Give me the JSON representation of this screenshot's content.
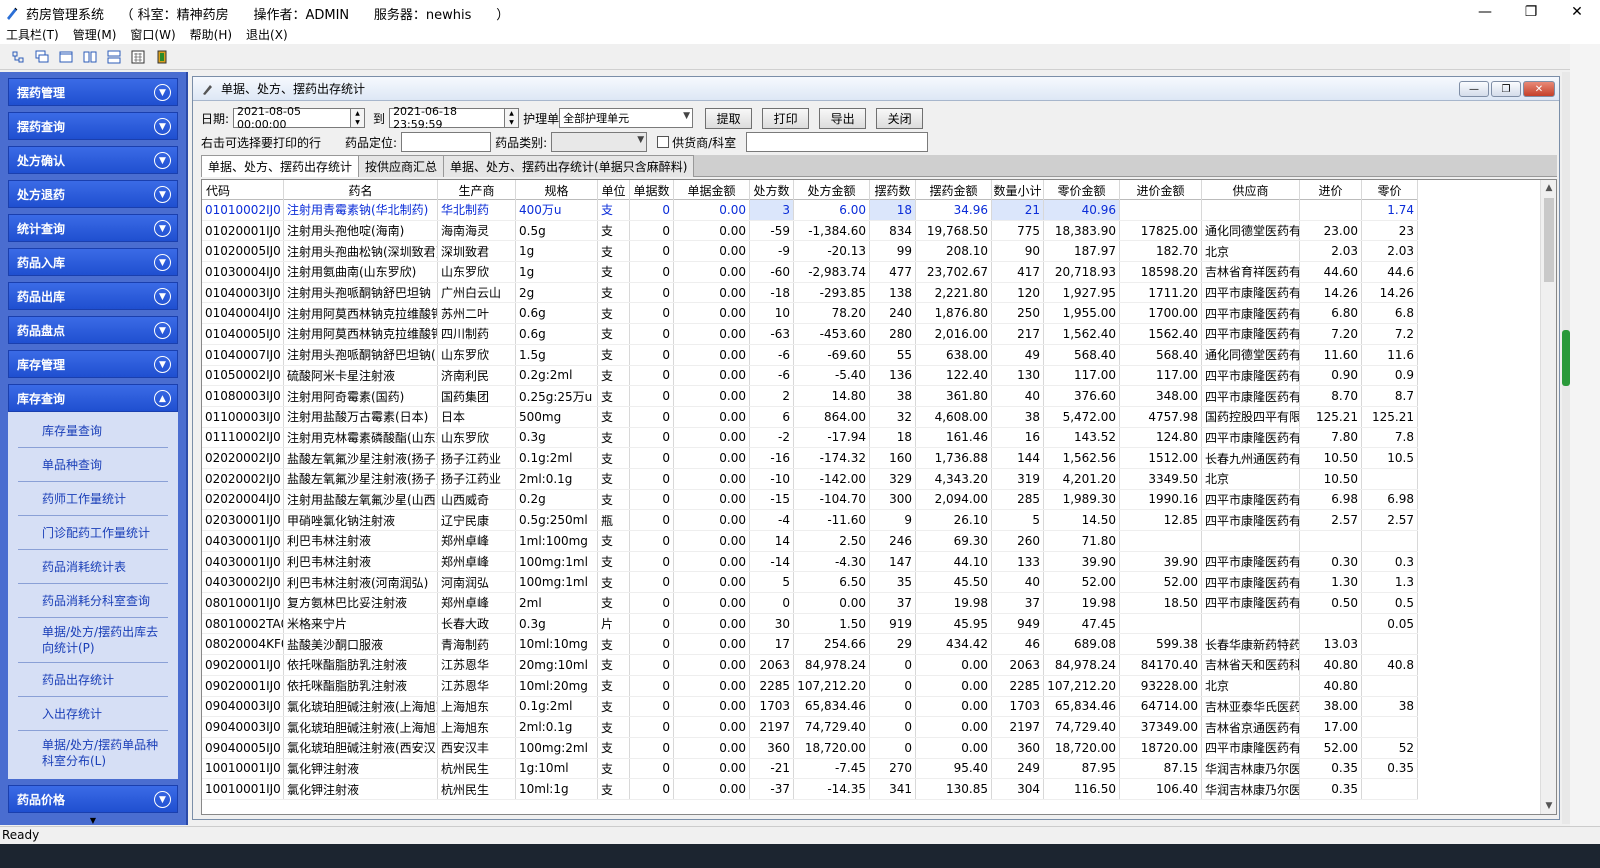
{
  "window": {
    "title": "药房管理系统    （ 科室：精神药房      操作者：ADMIN      服务器：newhis      ）",
    "minimize": "—",
    "maximize": "❐",
    "close": "✕"
  },
  "menu": [
    "工具栏(T)",
    "管理(M)",
    "窗口(W)",
    "帮助(H)",
    "退出(X)"
  ],
  "sidebar": {
    "groups": [
      {
        "label": "摆药管理"
      },
      {
        "label": "摆药查询"
      },
      {
        "label": "处方确认"
      },
      {
        "label": "处方退药"
      },
      {
        "label": "统计查询"
      },
      {
        "label": "药品入库"
      },
      {
        "label": "药品出库"
      },
      {
        "label": "药品盘点"
      },
      {
        "label": "库存管理"
      },
      {
        "label": "库存查询"
      }
    ],
    "submenu": [
      "库存量查询",
      "单品种查询",
      "药师工作量统计",
      "门诊配药工作量统计",
      "药品消耗统计表",
      "药品消耗分科室查询",
      "单据/处方/摆药出库去向统计(P)",
      "药品出存统计",
      "入出存统计",
      "单据/处方/摆药单品种科室分布(L)"
    ],
    "last_group": "药品价格"
  },
  "child": {
    "title": "单据、处方、摆药出存统计",
    "date_label": "日期:",
    "date_from": "2021-08-05 00:00:00",
    "to_label": "到",
    "date_to": "2021-06-18 23:59:59",
    "unit_label": "护理单",
    "unit_value": "全部护理单元",
    "btn_extract": "提取",
    "btn_print": "打印",
    "btn_export": "导出",
    "btn_close": "关闭",
    "hint": "右击可选择要打印的行",
    "locate_label": "药品定位:",
    "category_label": "药品类别:",
    "supplier_check": "供货商/科室",
    "tabs": [
      "单据、处方、摆药出存统计",
      "按供应商汇总",
      "单据、处方、摆药出存统计(单据只含麻醉料)"
    ]
  },
  "grid": {
    "columns": [
      "代码",
      "药名",
      "生产商",
      "规格",
      "单位",
      "单据数",
      "单据金额",
      "处方数",
      "处方金额",
      "摆药数",
      "摆药金额",
      "数量小计",
      "零价金额",
      "进价金额",
      "供应商",
      "进价",
      "零价"
    ],
    "rows": [
      [
        "01010002IJ0",
        "注射用青霉素钠(华北制药)",
        "华北制药",
        "400万u",
        "支",
        "0",
        "0.00",
        "3",
        "6.00",
        "18",
        "34.96",
        "21",
        "40.96",
        "",
        "",
        "",
        "1.74"
      ],
      [
        "01020001IJ0",
        "注射用头孢他啶(海南)",
        "海南海灵",
        "0.5g",
        "支",
        "0",
        "0.00",
        "-59",
        "-1,384.60",
        "834",
        "19,768.50",
        "775",
        "18,383.90",
        "17825.00",
        "通化同德堂医药有",
        "23.00",
        "23"
      ],
      [
        "01020005IJ0",
        "注射用头孢曲松钠(深圳致君)",
        "深圳致君",
        "1g",
        "支",
        "0",
        "0.00",
        "-9",
        "-20.13",
        "99",
        "208.10",
        "90",
        "187.97",
        "182.70",
        "北京",
        "2.03",
        "2.03"
      ],
      [
        "01030004IJ0",
        "注射用氨曲南(山东罗欣)",
        "山东罗欣",
        "1g",
        "支",
        "0",
        "0.00",
        "-60",
        "-2,983.74",
        "477",
        "23,702.67",
        "417",
        "20,718.93",
        "18598.20",
        "吉林省育祥医药有",
        "44.60",
        "44.6"
      ],
      [
        "01040003IJ0",
        "注射用头孢哌酮钠舒巴坦钠",
        "广州白云山",
        "2g",
        "支",
        "0",
        "0.00",
        "-18",
        "-293.85",
        "138",
        "2,221.80",
        "120",
        "1,927.95",
        "1711.20",
        "四平市康隆医药有",
        "14.26",
        "14.26"
      ],
      [
        "01040004IJ0",
        "注射用阿莫西林钠克拉维酸钾",
        "苏州二叶",
        "0.6g",
        "支",
        "0",
        "0.00",
        "10",
        "78.20",
        "240",
        "1,876.80",
        "250",
        "1,955.00",
        "1700.00",
        "四平市康隆医药有",
        "6.80",
        "6.8"
      ],
      [
        "01040005IJ0",
        "注射用阿莫西林钠克拉维酸钾",
        "四川制药",
        "0.6g",
        "支",
        "0",
        "0.00",
        "-63",
        "-453.60",
        "280",
        "2,016.00",
        "217",
        "1,562.40",
        "1562.40",
        "四平市康隆医药有",
        "7.20",
        "7.2"
      ],
      [
        "01040007IJ0",
        "注射用头孢哌酮钠舒巴坦钠(",
        "山东罗欣",
        "1.5g",
        "支",
        "0",
        "0.00",
        "-6",
        "-69.60",
        "55",
        "638.00",
        "49",
        "568.40",
        "568.40",
        "通化同德堂医药有",
        "11.60",
        "11.6"
      ],
      [
        "01050002IJ0",
        "硫酸阿米卡星注射液",
        "济南利民",
        "0.2g:2ml",
        "支",
        "0",
        "0.00",
        "-6",
        "-5.40",
        "136",
        "122.40",
        "130",
        "117.00",
        "117.00",
        "四平市康隆医药有",
        "0.90",
        "0.9"
      ],
      [
        "01080003IJ0",
        "注射用阿奇霉素(国药)",
        "国药集团",
        "0.25g:25万u",
        "支",
        "0",
        "0.00",
        "2",
        "14.80",
        "38",
        "361.80",
        "40",
        "376.60",
        "348.00",
        "四平市康隆医药有",
        "8.70",
        "8.7"
      ],
      [
        "01100003IJ0",
        "注射用盐酸万古霉素(日本)",
        "日本",
        "500mg",
        "支",
        "0",
        "0.00",
        "6",
        "864.00",
        "32",
        "4,608.00",
        "38",
        "5,472.00",
        "4757.98",
        "国药控股四平有限",
        "125.21",
        "125.21"
      ],
      [
        "01110002IJ0",
        "注射用克林霉素磷酸酯(山东罗",
        "山东罗欣",
        "0.3g",
        "支",
        "0",
        "0.00",
        "-2",
        "-17.94",
        "18",
        "161.46",
        "16",
        "143.52",
        "124.80",
        "四平市康隆医药有",
        "7.80",
        "7.8"
      ],
      [
        "02020002IJ0",
        "盐酸左氧氟沙星注射液(扬子)",
        "扬子江药业",
        "0.1g:2ml",
        "支",
        "0",
        "0.00",
        "-16",
        "-174.32",
        "160",
        "1,736.88",
        "144",
        "1,562.56",
        "1512.00",
        "长春九州通医药有",
        "10.50",
        "10.5"
      ],
      [
        "02020002IJ0",
        "盐酸左氧氟沙星注射液(扬子)",
        "扬子江药业",
        "2ml:0.1g",
        "支",
        "0",
        "0.00",
        "-10",
        "-142.00",
        "329",
        "4,343.20",
        "319",
        "4,201.20",
        "3349.50",
        "北京",
        "10.50",
        ""
      ],
      [
        "02020004IJ0",
        "注射用盐酸左氧氟沙星(山西",
        "山西威奇",
        "0.2g",
        "支",
        "0",
        "0.00",
        "-15",
        "-104.70",
        "300",
        "2,094.00",
        "285",
        "1,989.30",
        "1990.16",
        "四平市康隆医药有",
        "6.98",
        "6.98"
      ],
      [
        "02030001IJ0",
        "甲硝唑氯化钠注射液",
        "辽宁民康",
        "0.5g:250ml",
        "瓶",
        "0",
        "0.00",
        "-4",
        "-11.60",
        "9",
        "26.10",
        "5",
        "14.50",
        "12.85",
        "四平市康隆医药有",
        "2.57",
        "2.57"
      ],
      [
        "04030001IJ0",
        "利巴韦林注射液",
        "郑州卓峰",
        "1ml:100mg",
        "支",
        "0",
        "0.00",
        "14",
        "2.50",
        "246",
        "69.30",
        "260",
        "71.80",
        "",
        "",
        "",
        ""
      ],
      [
        "04030001IJ0",
        "利巴韦林注射液",
        "郑州卓峰",
        "100mg:1ml",
        "支",
        "0",
        "0.00",
        "-14",
        "-4.30",
        "147",
        "44.10",
        "133",
        "39.90",
        "39.90",
        "四平市康隆医药有",
        "0.30",
        "0.3"
      ],
      [
        "04030002IJ0",
        "利巴韦林注射液(河南润弘)",
        "河南润弘",
        "100mg:1ml",
        "支",
        "0",
        "0.00",
        "5",
        "6.50",
        "35",
        "45.50",
        "40",
        "52.00",
        "52.00",
        "四平市康隆医药有",
        "1.30",
        "1.3"
      ],
      [
        "08010001IJ0",
        "复方氨林巴比妥注射液",
        "郑州卓峰",
        "2ml",
        "支",
        "0",
        "0.00",
        "0",
        "0.00",
        "37",
        "19.98",
        "37",
        "19.98",
        "18.50",
        "四平市康隆医药有",
        "0.50",
        "0.5"
      ],
      [
        "08010002TA0",
        "米格来宁片",
        "长春大政",
        "0.3g",
        "片",
        "0",
        "0.00",
        "30",
        "1.50",
        "919",
        "45.95",
        "949",
        "47.45",
        "",
        "",
        "",
        "0.05"
      ],
      [
        "08020004KF0",
        "盐酸美沙酮口服液",
        "青海制药",
        "10ml:10mg",
        "支",
        "0",
        "0.00",
        "17",
        "254.66",
        "29",
        "434.42",
        "46",
        "689.08",
        "599.38",
        "长春华康新药特药",
        "13.03",
        ""
      ],
      [
        "09020001IJ0",
        "依托咪酯脂肪乳注射液",
        "江苏恩华",
        "20mg:10ml",
        "支",
        "0",
        "0.00",
        "2063",
        "84,978.24",
        "0",
        "0.00",
        "2063",
        "84,978.24",
        "84170.40",
        "吉林省天和医药科",
        "40.80",
        "40.8"
      ],
      [
        "09020001IJ0",
        "依托咪酯脂肪乳注射液",
        "江苏恩华",
        "10ml:20mg",
        "支",
        "0",
        "0.00",
        "2285",
        "107,212.20",
        "0",
        "0.00",
        "2285",
        "107,212.20",
        "93228.00",
        "北京",
        "40.80",
        ""
      ],
      [
        "09040003IJ0",
        "氯化琥珀胆碱注射液(上海旭东",
        "上海旭东",
        "0.1g:2ml",
        "支",
        "0",
        "0.00",
        "1703",
        "65,834.46",
        "0",
        "0.00",
        "1703",
        "65,834.46",
        "64714.00",
        "吉林亚泰华氏医药",
        "38.00",
        "38"
      ],
      [
        "09040003IJ0",
        "氯化琥珀胆碱注射液(上海旭东",
        "上海旭东",
        "2ml:0.1g",
        "支",
        "0",
        "0.00",
        "2197",
        "74,729.40",
        "0",
        "0.00",
        "2197",
        "74,729.40",
        "37349.00",
        "吉林省京通医药有",
        "17.00",
        ""
      ],
      [
        "09040005IJ0",
        "氯化琥珀胆碱注射液(西安汉",
        "西安汉丰",
        "100mg:2ml",
        "支",
        "0",
        "0.00",
        "360",
        "18,720.00",
        "0",
        "0.00",
        "360",
        "18,720.00",
        "18720.00",
        "四平市康隆医药有",
        "52.00",
        "52"
      ],
      [
        "10010001IJ0",
        "氯化钾注射液",
        "杭州民生",
        "1g:10ml",
        "支",
        "0",
        "0.00",
        "-21",
        "-7.45",
        "270",
        "95.40",
        "249",
        "87.95",
        "87.15",
        "华润吉林康乃尔医",
        "0.35",
        "0.35"
      ],
      [
        "10010001IJ0",
        "氯化钾注射液",
        "杭州民生",
        "10ml:1g",
        "支",
        "0",
        "0.00",
        "-37",
        "-14.35",
        "341",
        "130.85",
        "304",
        "116.50",
        "106.40",
        "华润吉林康乃尔医",
        "0.35",
        ""
      ]
    ]
  },
  "status": "Ready"
}
